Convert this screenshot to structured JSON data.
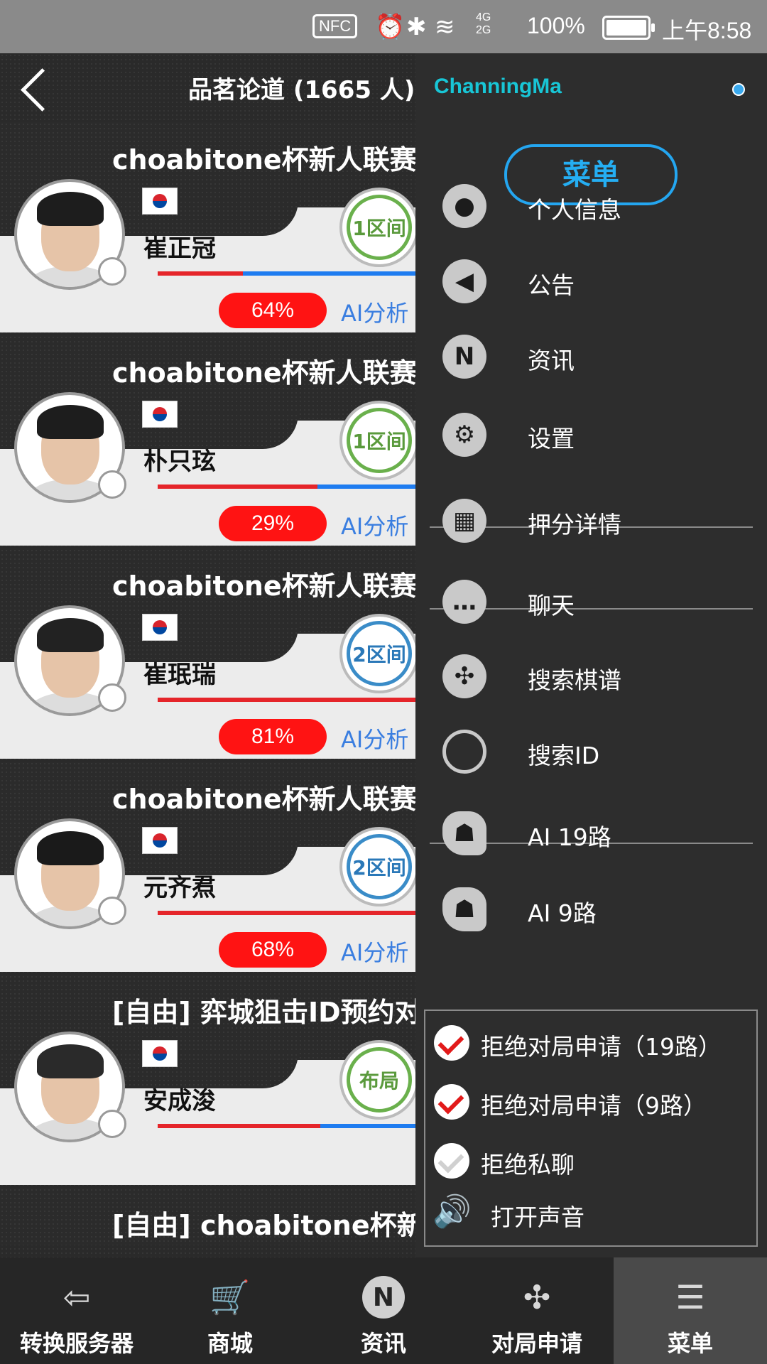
{
  "statusbar": {
    "nfc": "NFC",
    "network": "4G 2G",
    "battery": "100%",
    "time": "上午8:58"
  },
  "header": {
    "title": "品茗论道 (1665 人)"
  },
  "cards": [
    {
      "title": "choabitone杯新人联赛",
      "name": "崔正冠",
      "zone": "1区间",
      "zone_color": "green",
      "pct": "64%",
      "ai": "AI分析",
      "red_frac": 0.33
    },
    {
      "title": "choabitone杯新人联赛",
      "name": "朴只玹",
      "zone": "1区间",
      "zone_color": "green",
      "pct": "29%",
      "ai": "AI分析",
      "red_frac": 0.62
    },
    {
      "title": "choabitone杯新人联赛",
      "name": "崔珉瑞",
      "zone": "2区间",
      "zone_color": "blue",
      "pct": "81%",
      "ai": "AI分析",
      "red_frac": 1.0
    },
    {
      "title": "choabitone杯新人联赛",
      "name": "元齐焄",
      "zone": "2区间",
      "zone_color": "blue",
      "pct": "68%",
      "ai": "AI分析",
      "red_frac": 1.0
    },
    {
      "title": "[自由] 弈城狙击ID预约对局",
      "name": "安成浚",
      "zone": "布局",
      "zone_color": "green",
      "pct": "",
      "ai": "",
      "red_frac": 0.63
    },
    {
      "title": "[自由] choabitone杯新",
      "name": "",
      "zone": "",
      "zone_color": "green",
      "pct": "",
      "ai": "",
      "red_frac": 0
    }
  ],
  "drawer": {
    "username": "ChanningMa",
    "menu_label": "菜单",
    "items": [
      {
        "label": "个人信息",
        "icon": "person-icon",
        "glyph": "●"
      },
      {
        "label": "公告",
        "icon": "megaphone-icon",
        "glyph": "◀"
      },
      {
        "label": "资讯",
        "icon": "news-n-icon",
        "glyph": "N"
      },
      {
        "label": "设置",
        "icon": "gear-icon",
        "glyph": "⚙"
      },
      {
        "label": "押分详情",
        "icon": "calendar-icon",
        "glyph": "▦"
      },
      {
        "label": "聊天",
        "icon": "chat-icon",
        "glyph": "…"
      },
      {
        "label": "搜索棋谱",
        "icon": "go-stones-icon",
        "glyph": "✣"
      },
      {
        "label": "搜索ID",
        "icon": "magnifier-icon",
        "glyph": "○"
      },
      {
        "label": "AI 19路",
        "icon": "ai-head-icon",
        "glyph": "☗"
      },
      {
        "label": "AI 9路",
        "icon": "ai-head-icon",
        "glyph": "☗"
      }
    ],
    "options": [
      {
        "label": "拒绝对局申请（19路）",
        "checked": true
      },
      {
        "label": "拒绝对局申请（9路）",
        "checked": true
      },
      {
        "label": "拒绝私聊",
        "checked": false
      },
      {
        "label": "打开声音",
        "checked": true
      }
    ]
  },
  "bottom": [
    {
      "label": "转换服务器",
      "icon": "server-switch-icon",
      "glyph": "⇦"
    },
    {
      "label": "商城",
      "icon": "cart-icon",
      "glyph": "🛒"
    },
    {
      "label": "资讯",
      "icon": "news-n-icon",
      "glyph": "N"
    },
    {
      "label": "对局申请",
      "icon": "go-stones-icon",
      "glyph": "✣"
    },
    {
      "label": "菜单",
      "icon": "menu-list-icon",
      "glyph": "☰"
    }
  ],
  "colors": {
    "accent": "#25aef2",
    "username": "#18c6d6",
    "pct_bg": "#ff1313",
    "ai_link": "#3a7ee0"
  }
}
